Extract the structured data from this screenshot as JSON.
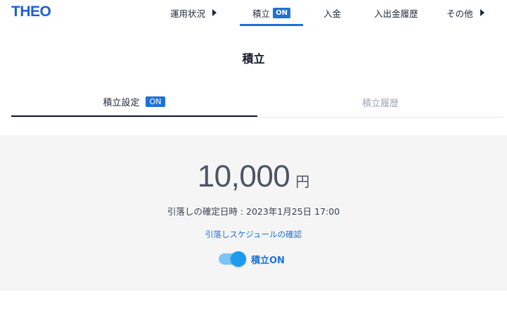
{
  "header": {
    "logo": "THEO",
    "nav": [
      {
        "label": "運用状況",
        "has_arrow": true
      },
      {
        "label": "積立",
        "badge": "ON",
        "active": true
      },
      {
        "label": "入金"
      },
      {
        "label": "入出金履歴"
      },
      {
        "label": "その他",
        "has_arrow": true
      }
    ]
  },
  "page": {
    "title": "積立"
  },
  "tabs": [
    {
      "label": "積立設定",
      "badge": "ON",
      "active": true
    },
    {
      "label": "積立履歴",
      "active": false
    }
  ],
  "panel": {
    "amount": "10,000",
    "unit": "円",
    "debit_label": "引落しの確定日時 : ",
    "debit_value": "2023年1月25日 17:00",
    "schedule_link": "引落しスケジュールの確認",
    "toggle_label": "積立ON",
    "toggle_on": true
  },
  "colors": {
    "accent": "#1d72d8",
    "logo": "#1d5fd6",
    "panel_bg": "#f5f5f5",
    "toggle_track": "#7cc4f5",
    "toggle_knob": "#1a9bf0"
  }
}
